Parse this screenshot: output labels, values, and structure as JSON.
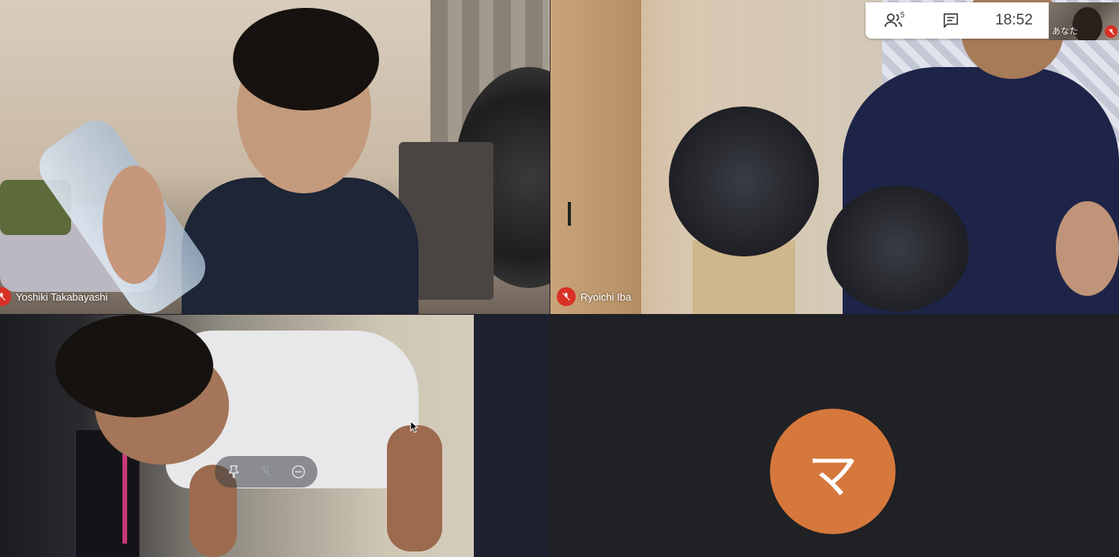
{
  "participants": [
    {
      "name": "Yoshiki Takabayashi",
      "muted": true
    },
    {
      "name": "Ryoichi Iba",
      "muted": true
    },
    {
      "name": "",
      "muted": false
    },
    {
      "name": "",
      "avatar_initial": "マ",
      "avatar_color": "#d6783c"
    }
  ],
  "topbar": {
    "people_icon": "people-icon",
    "people_count": "5",
    "chat_icon": "chat-icon",
    "clock": "18:52"
  },
  "self_view": {
    "label": "あなた",
    "muted": true
  },
  "tile_controls": {
    "pin_icon": "pin-icon",
    "mute_icon": "mic-off-icon",
    "remove_icon": "remove-icon"
  },
  "colors": {
    "background": "#202124",
    "mute_red": "#d93025",
    "avatar_orange": "#d6783c"
  }
}
